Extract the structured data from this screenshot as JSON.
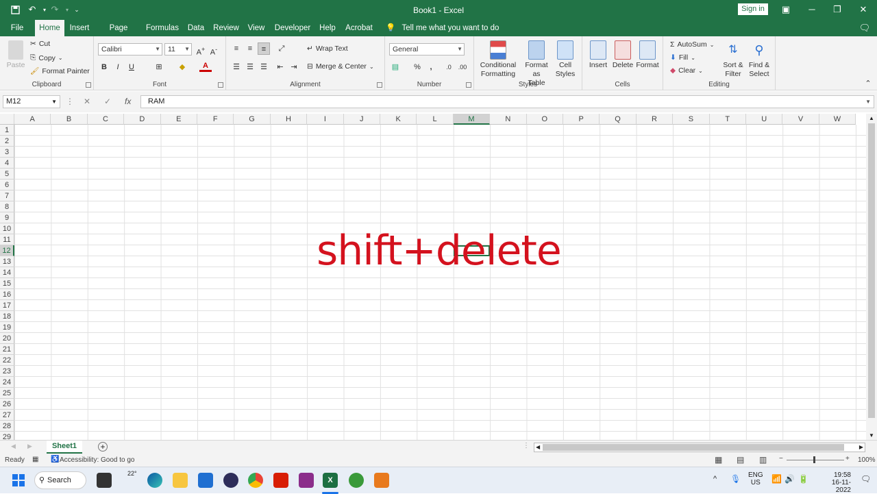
{
  "window": {
    "title": "Book1  -  Excel",
    "sign_in": "Sign in"
  },
  "qat": {
    "save": "save-icon",
    "undo": "undo-icon",
    "redo": "redo-icon"
  },
  "tabs": [
    "File",
    "Home",
    "Insert",
    "Page Layout",
    "Formulas",
    "Data",
    "Review",
    "View",
    "Developer",
    "Help",
    "Acrobat"
  ],
  "tell_me": "Tell me what you want to do",
  "ribbon": {
    "clipboard": {
      "label": "Clipboard",
      "paste": "Paste",
      "cut": "Cut",
      "copy": "Copy",
      "format_painter": "Format Painter"
    },
    "font": {
      "label": "Font",
      "name": "Calibri",
      "size": "11",
      "bold": "B",
      "italic": "I",
      "underline": "U"
    },
    "alignment": {
      "label": "Alignment",
      "wrap_text": "Wrap Text",
      "merge_center": "Merge & Center"
    },
    "number": {
      "label": "Number",
      "format": "General",
      "percent": "%",
      "comma": ","
    },
    "styles": {
      "label": "Styles",
      "conditional": "Conditional",
      "formatting": "Formatting",
      "format_as": "Format as",
      "table": "Table",
      "cell": "Cell",
      "styles_btn": "Styles"
    },
    "cells": {
      "label": "Cells",
      "insert": "Insert",
      "delete": "Delete",
      "format": "Format"
    },
    "editing": {
      "label": "Editing",
      "autosum": "AutoSum",
      "fill": "Fill",
      "clear": "Clear",
      "sort": "Sort &",
      "filter": "Filter",
      "find": "Find &",
      "select": "Select"
    }
  },
  "formula_bar": {
    "name_box": "M12",
    "content": "RAM"
  },
  "columns": [
    "A",
    "B",
    "C",
    "D",
    "E",
    "F",
    "G",
    "H",
    "I",
    "J",
    "K",
    "L",
    "M",
    "N",
    "O",
    "P",
    "Q",
    "R",
    "S",
    "T",
    "U",
    "V",
    "W"
  ],
  "rows": [
    "1",
    "2",
    "3",
    "4",
    "5",
    "6",
    "7",
    "8",
    "9",
    "10",
    "11",
    "12",
    "13",
    "14",
    "15",
    "16",
    "17",
    "18",
    "19",
    "20",
    "21",
    "22",
    "23",
    "24",
    "25",
    "26",
    "27",
    "28",
    "29"
  ],
  "overlay_text": "shift+delete",
  "sheet_tab": "Sheet1",
  "status": {
    "ready": "Ready",
    "accessibility": "Accessibility: Good to go",
    "zoom": "100%"
  },
  "taskbar": {
    "search": "Search",
    "weather": "22°",
    "lang1": "ENG",
    "lang2": "US",
    "time": "19:58",
    "date": "16-11-2022"
  },
  "colors": {
    "excel_green": "#217346",
    "overlay_red": "#d4121e"
  }
}
